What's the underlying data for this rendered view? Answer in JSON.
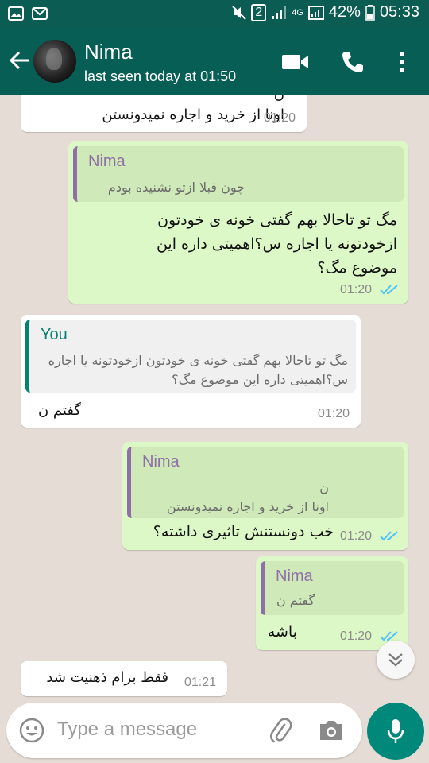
{
  "status_bar": {
    "sim": "2",
    "net": "4G",
    "battery": "42%",
    "time": "05:33"
  },
  "header": {
    "name": "Nima",
    "status": "last seen today at 01:50"
  },
  "messages": [
    {
      "text": "ن\nاونا از خرید و اجاره نمیدونستن",
      "time": "01:20"
    },
    {
      "quote_author": "Nima",
      "quote_text": "چون قبلا ازتو نشنیده بودم",
      "text": "مگ تو تاحالا بهم گفتی خونه ی خودتون ازخودتونه یا اجاره س؟اهمیتی داره این موضوع مگ؟",
      "time": "01:20"
    },
    {
      "quote_author": "You",
      "quote_text": "مگ تو تاحالا بهم گفتی خونه ی خودتون ازخودتونه یا اجاره س؟اهمیتی داره این موضوع مگ؟",
      "text": "گفتم ن",
      "time": "01:20"
    },
    {
      "quote_author": "Nima",
      "quote_text": "ن\nاونا از خرید و اجاره نمیدونستن",
      "text": "خب دونستنش تاثیری داشته؟",
      "time": "01:20"
    },
    {
      "quote_author": "Nima",
      "quote_text": "گفتم ن",
      "text": "باشه",
      "time": "01:20"
    },
    {
      "text": "فقط برام ذهنیت شد",
      "time": "01:21"
    }
  ],
  "input": {
    "placeholder": "Type a message"
  },
  "colors": {
    "header": "#075e54",
    "status_bar": "#0b5d54",
    "outgoing": "#dcf8c6",
    "incoming": "#ffffff",
    "background": "#e5ddd5",
    "accent": "#00897b"
  },
  "icons": [
    "back-arrow-icon",
    "video-call-icon",
    "phone-icon",
    "more-vert-icon",
    "emoji-icon",
    "attach-icon",
    "camera-icon",
    "mic-icon",
    "double-chevron-down-icon",
    "read-ticks-icon"
  ]
}
